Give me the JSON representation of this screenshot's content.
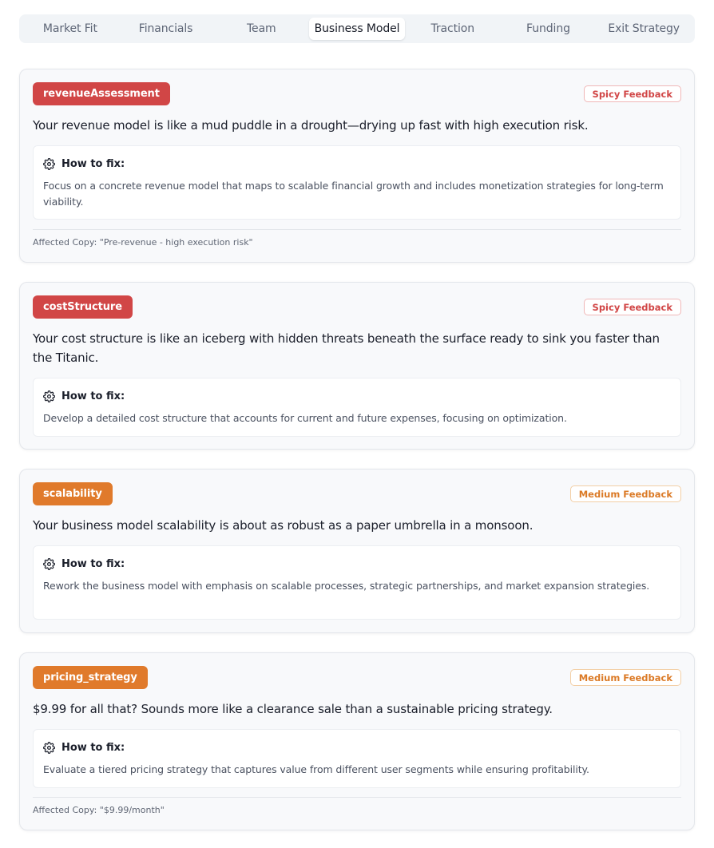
{
  "tabs": [
    {
      "label": "Market Fit",
      "active": false
    },
    {
      "label": "Financials",
      "active": false
    },
    {
      "label": "Team",
      "active": false
    },
    {
      "label": "Business Model",
      "active": true
    },
    {
      "label": "Traction",
      "active": false
    },
    {
      "label": "Funding",
      "active": false
    },
    {
      "label": "Exit Strategy",
      "active": false
    }
  ],
  "colors": {
    "spicy": "#d14646",
    "medium": "#e07a2b"
  },
  "fix_icon": "gear-icon",
  "cards": [
    {
      "tag": "revenueAssessment",
      "severity": "Spicy Feedback",
      "level": "spicy",
      "message": "Your revenue model is like a mud puddle in a drought—drying up fast with high execution risk.",
      "fix_title": "How to fix:",
      "fix_text": "Focus on a concrete revenue model that maps to scalable financial growth and includes monetization strategies for long-term viability.",
      "affected": "Affected Copy: \"Pre-revenue - high execution risk\""
    },
    {
      "tag": "costStructure",
      "severity": "Spicy Feedback",
      "level": "spicy",
      "message": "Your cost structure is like an iceberg with hidden threats beneath the surface ready to sink you faster than the Titanic.",
      "fix_title": "How to fix:",
      "fix_text": "Develop a detailed cost structure that accounts for current and future expenses, focusing on optimization."
    },
    {
      "tag": "scalability",
      "severity": "Medium Feedback",
      "level": "medium",
      "message": "Your business model scalability is about as robust as a paper umbrella in a monsoon.",
      "fix_title": "How to fix:",
      "fix_text": "Rework the business model with emphasis on scalable processes, strategic partnerships, and market expansion strategies."
    },
    {
      "tag": "pricing_strategy",
      "severity": "Medium Feedback",
      "level": "medium",
      "message": "$9.99 for all that? Sounds more like a clearance sale than a sustainable pricing strategy.",
      "fix_title": "How to fix:",
      "fix_text": "Evaluate a tiered pricing strategy that captures value from different user segments while ensuring profitability.",
      "affected": "Affected Copy: \"$9.99/month\""
    }
  ]
}
